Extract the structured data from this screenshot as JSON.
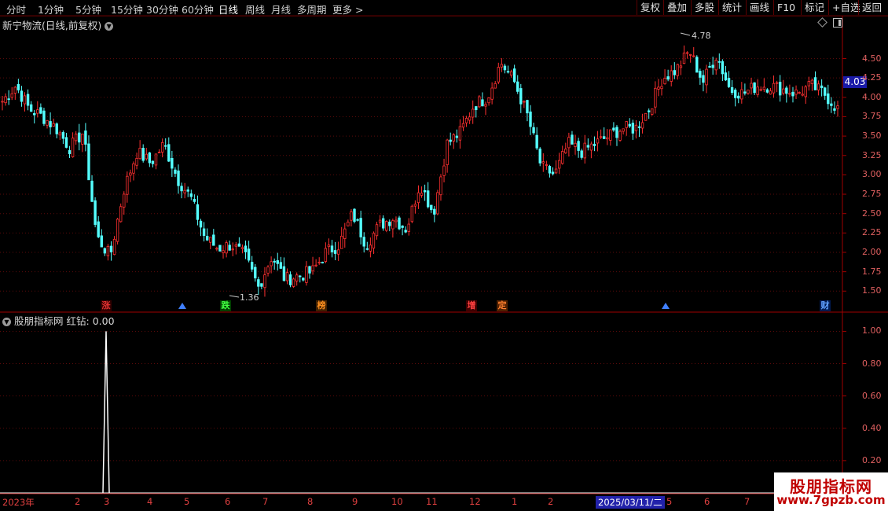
{
  "toolbar": {
    "periods": [
      "分时",
      "1分钟",
      "5分钟",
      "15分钟",
      "30分钟",
      "60分钟",
      "日线",
      "周线",
      "月线",
      "多周期",
      "更多 >"
    ],
    "active_period": "日线",
    "buttons": [
      "复权",
      "叠加",
      "多股",
      "统计",
      "画线",
      "F10",
      "标记",
      "+自选",
      "返回"
    ]
  },
  "main_chart": {
    "title": "新宁物流(日线,前复权)",
    "current_price": "4.03",
    "high_label": "4.78",
    "low_label": "1.36",
    "y_ticks": [
      "4.50",
      "4.25",
      "4.00",
      "3.75",
      "3.50",
      "3.25",
      "3.00",
      "2.75",
      "2.50",
      "2.25",
      "2.00",
      "1.75",
      "1.50"
    ],
    "markers": [
      {
        "label": "涨",
        "color": "#e03030",
        "bg": "#300000"
      },
      {
        "label": "跌",
        "color": "#40ff40",
        "bg": "#004000"
      },
      {
        "label": "榜",
        "color": "#ff9020",
        "bg": "#402000"
      },
      {
        "label": "增",
        "color": "#ff4040",
        "bg": "#400000"
      },
      {
        "label": "定",
        "color": "#ff8030",
        "bg": "#502000"
      },
      {
        "label": "财",
        "color": "#60a0ff",
        "bg": "#001a50"
      }
    ]
  },
  "sub_chart": {
    "title": "股朋指标网",
    "indicator_name": "红钻:",
    "indicator_value": "0.00",
    "y_ticks": [
      "1.00",
      "0.80",
      "0.60",
      "0.40",
      "0.20"
    ]
  },
  "x_axis": {
    "labels": [
      "2023年",
      "2",
      "3",
      "4",
      "5",
      "6",
      "7",
      "8",
      "9",
      "10",
      "11",
      "12",
      "1",
      "2",
      "3",
      "2025/03/11/二",
      "5",
      "6",
      "7"
    ]
  },
  "watermark": {
    "title": "股朋指标网",
    "url": "www.7gpzb.com"
  },
  "chart_data": {
    "type": "candlestick",
    "title": "新宁物流(日线,前复权)",
    "ylim": [
      1.3,
      4.85
    ],
    "y_ticks": [
      4.5,
      4.25,
      4.0,
      3.75,
      3.5,
      3.25,
      3.0,
      2.75,
      2.5,
      2.25,
      2.0,
      1.75,
      1.5
    ],
    "trend_close": [
      3.95,
      4.15,
      3.85,
      3.75,
      3.6,
      3.35,
      3.55,
      2.2,
      1.95,
      2.8,
      3.3,
      3.15,
      3.4,
      2.95,
      2.7,
      2.2,
      2.05,
      2.1,
      1.95,
      1.55,
      1.95,
      1.65,
      1.7,
      1.75,
      2.0,
      2.1,
      2.5,
      2.1,
      2.35,
      2.45,
      2.3,
      2.9,
      2.5,
      3.4,
      3.55,
      3.9,
      4.0,
      4.45,
      4.2,
      3.75,
      3.1,
      3.0,
      3.4,
      3.3,
      3.4,
      3.5,
      3.6,
      3.6,
      3.85,
      4.25,
      4.35,
      4.6,
      4.2,
      4.55,
      4.1,
      4.05,
      4.15,
      4.15,
      4.1,
      4.05,
      4.15,
      4.05,
      3.85
    ],
    "sub_indicator": {
      "name": "红钻",
      "value": 0.0,
      "spike_value": 1.0,
      "ylim": [
        0,
        1.08
      ]
    }
  }
}
